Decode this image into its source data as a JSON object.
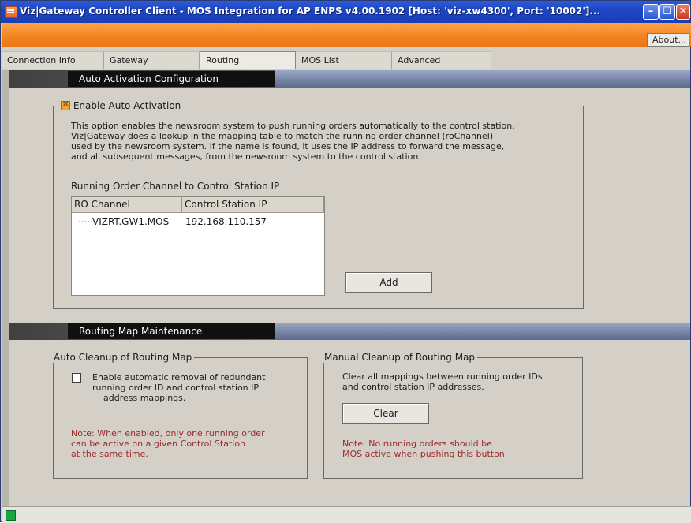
{
  "window": {
    "title": "Viz|Gateway Controller Client - MOS Integration for AP ENPS v4.00.1902    [Host: 'viz-xw4300', Port: '10002']..."
  },
  "header": {
    "about_label": "About..."
  },
  "tabs": [
    {
      "label": "Connection Info",
      "active": false
    },
    {
      "label": "Gateway",
      "active": false
    },
    {
      "label": "Routing",
      "active": true
    },
    {
      "label": "MOS List",
      "active": false
    },
    {
      "label": "Advanced",
      "active": false
    }
  ],
  "auto_activation": {
    "section_title": "Auto Activation Configuration",
    "enable_label": "Enable Auto Activation",
    "enabled": true,
    "description_lines": [
      "This option enables the newsroom system to push running orders automatically to the control station.",
      "Viz|Gateway does a lookup in the mapping table to match the running order channel (roChannel)",
      "used by the newsroom system. If the name is found, it uses the IP address to forward the message,",
      "and all subsequent messages, from the newsroom system to the control station."
    ],
    "table_title": "Running Order Channel to Control Station IP",
    "columns": [
      "RO Channel",
      "Control Station IP"
    ],
    "rows": [
      {
        "ro_channel": "VIZRT.GW1.MOS",
        "ip": "192.168.110.157"
      }
    ],
    "add_label": "Add"
  },
  "routing_map": {
    "section_title": "Routing Map Maintenance",
    "auto_cleanup": {
      "legend": "Auto Cleanup of Routing Map",
      "checkbox_checked": false,
      "checkbox_lines": [
        "Enable automatic removal of redundant",
        "running order ID and control station IP",
        "address mappings."
      ],
      "note_lines": [
        "Note: When enabled, only one running order",
        "can be active on a given Control Station",
        "at the same time."
      ]
    },
    "manual_cleanup": {
      "legend": "Manual Cleanup of Routing Map",
      "desc_lines": [
        "Clear all mappings between running order IDs",
        "and control station IP addresses."
      ],
      "clear_label": "Clear",
      "note_lines": [
        "Note: No running orders should be",
        "MOS active when pushing this button."
      ]
    }
  },
  "colors": {
    "titlebar": "#1d46c4",
    "header_orange": "#f28422",
    "note_red": "#9a2a2a",
    "status_green": "#17a840"
  }
}
